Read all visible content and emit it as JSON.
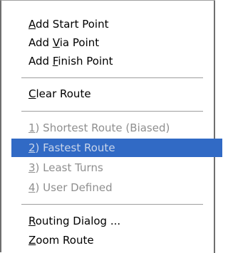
{
  "menu": {
    "groups": [
      {
        "items": [
          {
            "pre": "",
            "mnemonic": "A",
            "post": "dd  Start Point",
            "state": "enabled"
          },
          {
            "pre": "Add ",
            "mnemonic": "V",
            "post": "ia Point",
            "state": "enabled"
          },
          {
            "pre": "Add ",
            "mnemonic": "F",
            "post": "inish Point",
            "state": "enabled"
          }
        ]
      },
      {
        "items": [
          {
            "pre": "",
            "mnemonic": "C",
            "post": "lear Route",
            "state": "enabled"
          }
        ]
      },
      {
        "items": [
          {
            "pre": "",
            "mnemonic": "1",
            "post": ") Shortest Route (Biased)",
            "state": "disabled"
          },
          {
            "pre": "",
            "mnemonic": "2",
            "post": ") Fastest Route",
            "state": "selected-disabled"
          },
          {
            "pre": "",
            "mnemonic": "3",
            "post": ") Least Turns",
            "state": "disabled"
          },
          {
            "pre": "",
            "mnemonic": "4",
            "post": ") User Defined",
            "state": "disabled"
          }
        ]
      },
      {
        "items": [
          {
            "pre": "",
            "mnemonic": "R",
            "post": "outing Dialog ...",
            "state": "enabled"
          },
          {
            "pre": "",
            "mnemonic": "Z",
            "post": "oom Route",
            "state": "enabled"
          }
        ]
      }
    ]
  },
  "colors": {
    "highlight": "#316ac5",
    "disabled_text": "#8f8f8f",
    "border": "#6f6f6f"
  }
}
